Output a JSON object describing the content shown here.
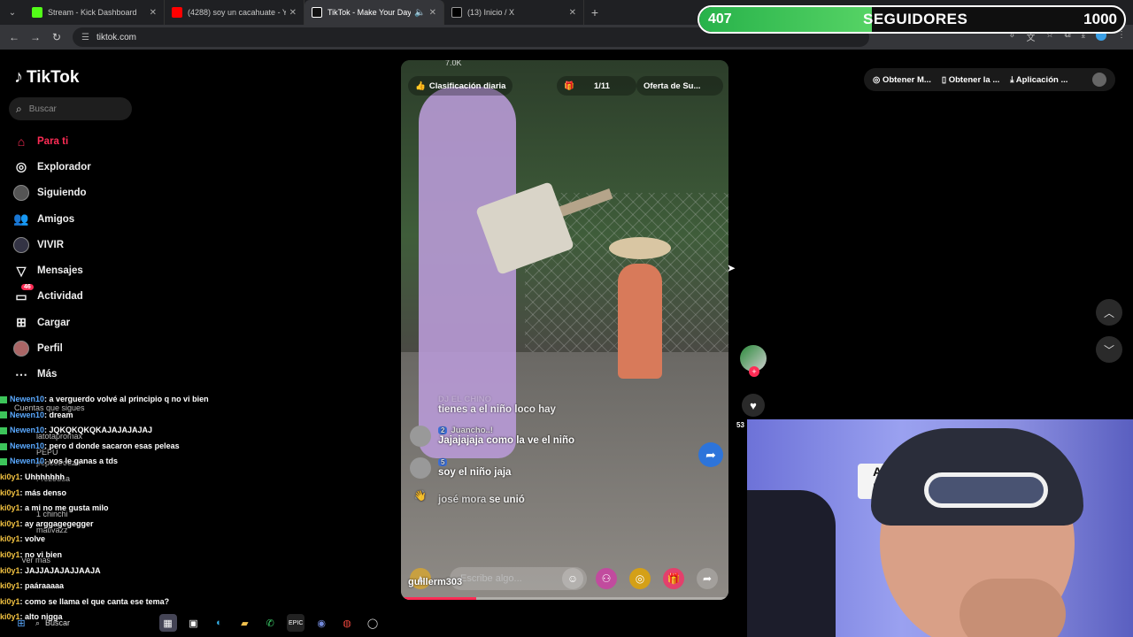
{
  "browser": {
    "tabs": [
      {
        "title": "Stream - Kick Dashboard",
        "favicon_color": "#53fc18",
        "active": false
      },
      {
        "title": "(4288) soy un cacahuate - Y",
        "favicon_color": "#ff0000",
        "active": false
      },
      {
        "title": "TikTok - Make Your Day",
        "favicon_color": "#ffffff",
        "active": true
      },
      {
        "title": "(13) Inicio / X",
        "favicon_color": "#ffffff",
        "active": false
      }
    ],
    "url": "tiktok.com"
  },
  "overlay_counter": {
    "current": "407",
    "label": "SEGUIDORES",
    "goal": "1000",
    "progress": 0.407
  },
  "tiktok": {
    "logo": "TikTok",
    "search_placeholder": "Buscar",
    "nav": [
      {
        "label": "Para ti",
        "icon": "home-icon",
        "active": true
      },
      {
        "label": "Explorador",
        "icon": "compass-icon"
      },
      {
        "label": "Siguiendo",
        "icon": "following-icon"
      },
      {
        "label": "Amigos",
        "icon": "friends-icon"
      },
      {
        "label": "VIVIR",
        "icon": "live-icon"
      },
      {
        "label": "Mensajes",
        "icon": "messages-icon"
      },
      {
        "label": "Actividad",
        "icon": "activity-icon",
        "badge": "46"
      },
      {
        "label": "Cargar",
        "icon": "upload-icon"
      },
      {
        "label": "Perfil",
        "icon": "profile-icon"
      },
      {
        "label": "Más",
        "icon": "more-icon"
      }
    ],
    "video": {
      "viewers": "7.0K",
      "ranking_label": "Clasificación diaria",
      "page_counter": "1/11",
      "offer_label": "Oferta de Su...",
      "comments": [
        {
          "user": "DJ EL CHINO",
          "text": "tienes a el niño loco hay",
          "level": ""
        },
        {
          "user": "Juancho..!",
          "text": "Jajajajaja como la ve el niño",
          "level": "2"
        },
        {
          "user": "",
          "text": "soy el niño jaja",
          "level": "5"
        }
      ],
      "joined_user": "josé mora",
      "joined_text": "se unió",
      "input_placeholder": "Escribe algo...",
      "streamer": "guillerm303",
      "progress": 0.23
    },
    "right_bar": {
      "likes": "53"
    },
    "top_right": [
      "Obtener M...",
      "Obtener la ...",
      "Aplicación ..."
    ]
  },
  "chat": [
    {
      "user": "Newen10",
      "text": ": a verguerdo volvé al principio q no vi bien",
      "color": "blue"
    },
    {
      "user": "Newen10",
      "text": ": dream",
      "color": "blue"
    },
    {
      "user": "Newen10",
      "text": ": JQKQKQKQKAJAJAJAJAJ",
      "color": "blue"
    },
    {
      "user": "Newen10",
      "text": ": pero d donde sacaron esas peleas",
      "color": "blue"
    },
    {
      "user": "Newen10",
      "text": ": vos le ganas a tds",
      "color": "blue"
    },
    {
      "user": "ki0y1",
      "text": ": Uhhhhhhh",
      "color": "gold"
    },
    {
      "user": "ki0y1",
      "text": ": más denso",
      "color": "gold"
    },
    {
      "user": "ki0y1",
      "text": ": a mi no me gusta milo",
      "color": "gold"
    },
    {
      "user": "ki0y1",
      "text": ": ay arggagegegger",
      "color": "gold"
    },
    {
      "user": "ki0y1",
      "text": ": volve",
      "color": "gold"
    },
    {
      "user": "ki0y1",
      "text": ": no vi bien",
      "color": "gold"
    },
    {
      "user": "ki0y1",
      "text": ": JAJJAJAJAJJAAJA",
      "color": "gold"
    },
    {
      "user": "ki0y1",
      "text": ": paáraaaaa",
      "color": "gold"
    },
    {
      "user": "ki0y1",
      "text": ": como se llama el que canta ese tema?",
      "color": "gold"
    },
    {
      "user": "ki0y1",
      "text": ": alto nigga",
      "color": "gold"
    }
  ],
  "following_ghost": [
    "Cuentas que sigues",
    "latotapromax",
    "PEPU",
    "pepostrouza",
    "Frozodua",
    "1 chinchi",
    "mativazz",
    "Ver más"
  ],
  "taskbar": {
    "search": "Buscar"
  },
  "colors": {
    "accent": "#fe2c55",
    "counter_green": "#27b24a"
  }
}
